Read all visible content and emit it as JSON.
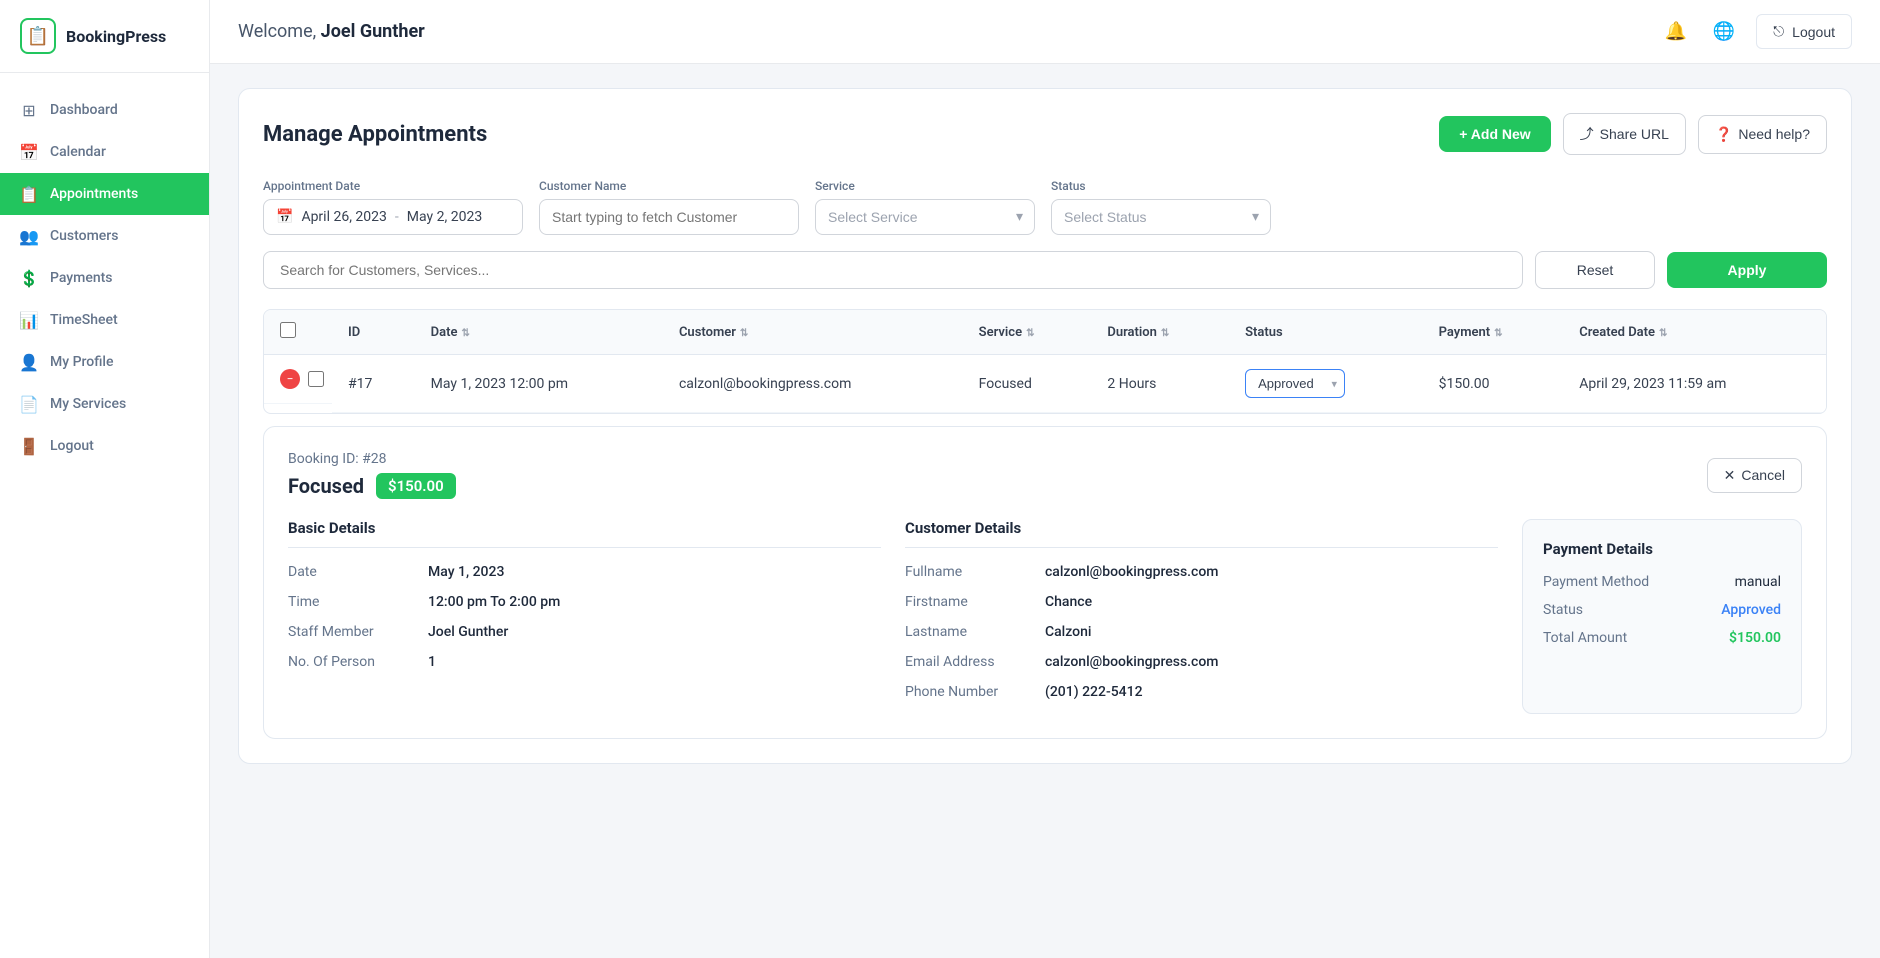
{
  "sidebar": {
    "logo": {
      "icon": "📋",
      "text": "BookingPress"
    },
    "nav": [
      {
        "id": "dashboard",
        "label": "Dashboard",
        "icon": "⊞",
        "active": false
      },
      {
        "id": "calendar",
        "label": "Calendar",
        "icon": "📅",
        "active": false
      },
      {
        "id": "appointments",
        "label": "Appointments",
        "icon": "📋",
        "active": true
      },
      {
        "id": "customers",
        "label": "Customers",
        "icon": "👥",
        "active": false
      },
      {
        "id": "payments",
        "label": "Payments",
        "icon": "💲",
        "active": false
      },
      {
        "id": "timesheet",
        "label": "TimeSheet",
        "icon": "📊",
        "active": false
      },
      {
        "id": "myprofile",
        "label": "My Profile",
        "icon": "👤",
        "active": false
      },
      {
        "id": "myservices",
        "label": "My Services",
        "icon": "📄",
        "active": false
      },
      {
        "id": "logout",
        "label": "Logout",
        "icon": "🚪",
        "active": false
      }
    ]
  },
  "topbar": {
    "welcome": "Welcome, ",
    "username": "Joel Gunther",
    "logout_label": "Logout"
  },
  "page": {
    "title": "Manage Appointments",
    "add_new_label": "+ Add New",
    "share_url_label": "Share URL",
    "need_help_label": "Need help?"
  },
  "filters": {
    "appointment_date_label": "Appointment Date",
    "date_from": "April 26, 2023",
    "date_to": "May 2, 2023",
    "customer_name_label": "Customer Name",
    "customer_placeholder": "Start typing to fetch Customer",
    "service_label": "Service",
    "service_placeholder": "Select Service",
    "status_label": "Status",
    "status_placeholder": "Select Status",
    "search_placeholder": "Search for Customers, Services...",
    "reset_label": "Reset",
    "apply_label": "Apply"
  },
  "table": {
    "columns": [
      "ID",
      "Date",
      "Customer",
      "Service",
      "Duration",
      "Status",
      "Payment",
      "Created Date"
    ],
    "rows": [
      {
        "id": "#17",
        "date": "May 1, 2023 12:00 pm",
        "customer": "calzonl@bookingpress.com",
        "service": "Focused",
        "duration": "2 Hours",
        "status": "Approved",
        "payment": "$150.00",
        "created_date": "April 29, 2023 11:59 am"
      }
    ]
  },
  "booking_panel": {
    "booking_id": "Booking ID: #28",
    "service_name": "Focused",
    "price": "$150.00",
    "cancel_label": "Cancel",
    "basic_details_title": "Basic Details",
    "date_label": "Date",
    "date_value": "May 1, 2023",
    "time_label": "Time",
    "time_value": "12:00 pm To 2:00 pm",
    "staff_label": "Staff Member",
    "staff_value": "Joel Gunther",
    "persons_label": "No. Of Person",
    "persons_value": "1",
    "customer_details_title": "Customer Details",
    "fullname_label": "Fullname",
    "fullname_value": "calzonl@bookingpress.com",
    "firstname_label": "Firstname",
    "firstname_value": "Chance",
    "lastname_label": "Lastname",
    "lastname_value": "Calzoni",
    "email_label": "Email Address",
    "email_value": "calzonl@bookingpress.com",
    "phone_label": "Phone Number",
    "phone_value": "(201) 222-5412",
    "payment_details_title": "Payment Details",
    "payment_method_label": "Payment Method",
    "payment_method_value": "manual",
    "payment_status_label": "Status",
    "payment_status_value": "Approved",
    "total_amount_label": "Total Amount",
    "total_amount_value": "$150.00"
  }
}
